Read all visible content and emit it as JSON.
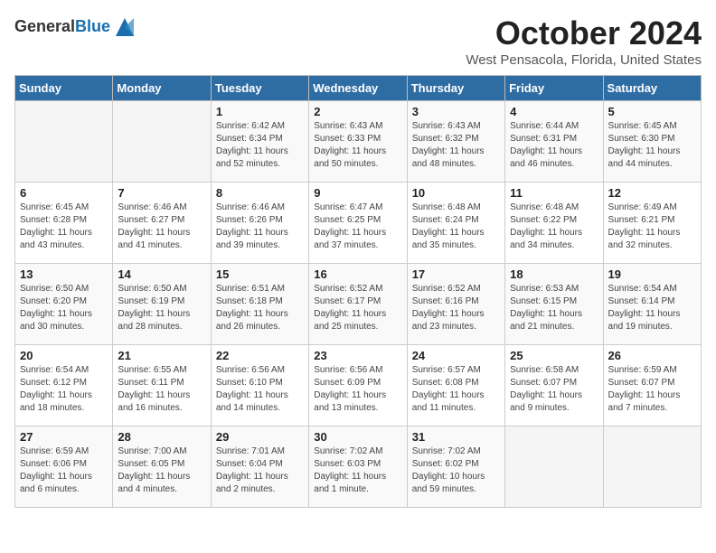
{
  "logo": {
    "general": "General",
    "blue": "Blue"
  },
  "title": "October 2024",
  "subtitle": "West Pensacola, Florida, United States",
  "days_header": [
    "Sunday",
    "Monday",
    "Tuesday",
    "Wednesday",
    "Thursday",
    "Friday",
    "Saturday"
  ],
  "weeks": [
    [
      {
        "day": "",
        "detail": ""
      },
      {
        "day": "",
        "detail": ""
      },
      {
        "day": "1",
        "detail": "Sunrise: 6:42 AM\nSunset: 6:34 PM\nDaylight: 11 hours\nand 52 minutes."
      },
      {
        "day": "2",
        "detail": "Sunrise: 6:43 AM\nSunset: 6:33 PM\nDaylight: 11 hours\nand 50 minutes."
      },
      {
        "day": "3",
        "detail": "Sunrise: 6:43 AM\nSunset: 6:32 PM\nDaylight: 11 hours\nand 48 minutes."
      },
      {
        "day": "4",
        "detail": "Sunrise: 6:44 AM\nSunset: 6:31 PM\nDaylight: 11 hours\nand 46 minutes."
      },
      {
        "day": "5",
        "detail": "Sunrise: 6:45 AM\nSunset: 6:30 PM\nDaylight: 11 hours\nand 44 minutes."
      }
    ],
    [
      {
        "day": "6",
        "detail": "Sunrise: 6:45 AM\nSunset: 6:28 PM\nDaylight: 11 hours\nand 43 minutes."
      },
      {
        "day": "7",
        "detail": "Sunrise: 6:46 AM\nSunset: 6:27 PM\nDaylight: 11 hours\nand 41 minutes."
      },
      {
        "day": "8",
        "detail": "Sunrise: 6:46 AM\nSunset: 6:26 PM\nDaylight: 11 hours\nand 39 minutes."
      },
      {
        "day": "9",
        "detail": "Sunrise: 6:47 AM\nSunset: 6:25 PM\nDaylight: 11 hours\nand 37 minutes."
      },
      {
        "day": "10",
        "detail": "Sunrise: 6:48 AM\nSunset: 6:24 PM\nDaylight: 11 hours\nand 35 minutes."
      },
      {
        "day": "11",
        "detail": "Sunrise: 6:48 AM\nSunset: 6:22 PM\nDaylight: 11 hours\nand 34 minutes."
      },
      {
        "day": "12",
        "detail": "Sunrise: 6:49 AM\nSunset: 6:21 PM\nDaylight: 11 hours\nand 32 minutes."
      }
    ],
    [
      {
        "day": "13",
        "detail": "Sunrise: 6:50 AM\nSunset: 6:20 PM\nDaylight: 11 hours\nand 30 minutes."
      },
      {
        "day": "14",
        "detail": "Sunrise: 6:50 AM\nSunset: 6:19 PM\nDaylight: 11 hours\nand 28 minutes."
      },
      {
        "day": "15",
        "detail": "Sunrise: 6:51 AM\nSunset: 6:18 PM\nDaylight: 11 hours\nand 26 minutes."
      },
      {
        "day": "16",
        "detail": "Sunrise: 6:52 AM\nSunset: 6:17 PM\nDaylight: 11 hours\nand 25 minutes."
      },
      {
        "day": "17",
        "detail": "Sunrise: 6:52 AM\nSunset: 6:16 PM\nDaylight: 11 hours\nand 23 minutes."
      },
      {
        "day": "18",
        "detail": "Sunrise: 6:53 AM\nSunset: 6:15 PM\nDaylight: 11 hours\nand 21 minutes."
      },
      {
        "day": "19",
        "detail": "Sunrise: 6:54 AM\nSunset: 6:14 PM\nDaylight: 11 hours\nand 19 minutes."
      }
    ],
    [
      {
        "day": "20",
        "detail": "Sunrise: 6:54 AM\nSunset: 6:12 PM\nDaylight: 11 hours\nand 18 minutes."
      },
      {
        "day": "21",
        "detail": "Sunrise: 6:55 AM\nSunset: 6:11 PM\nDaylight: 11 hours\nand 16 minutes."
      },
      {
        "day": "22",
        "detail": "Sunrise: 6:56 AM\nSunset: 6:10 PM\nDaylight: 11 hours\nand 14 minutes."
      },
      {
        "day": "23",
        "detail": "Sunrise: 6:56 AM\nSunset: 6:09 PM\nDaylight: 11 hours\nand 13 minutes."
      },
      {
        "day": "24",
        "detail": "Sunrise: 6:57 AM\nSunset: 6:08 PM\nDaylight: 11 hours\nand 11 minutes."
      },
      {
        "day": "25",
        "detail": "Sunrise: 6:58 AM\nSunset: 6:07 PM\nDaylight: 11 hours\nand 9 minutes."
      },
      {
        "day": "26",
        "detail": "Sunrise: 6:59 AM\nSunset: 6:07 PM\nDaylight: 11 hours\nand 7 minutes."
      }
    ],
    [
      {
        "day": "27",
        "detail": "Sunrise: 6:59 AM\nSunset: 6:06 PM\nDaylight: 11 hours\nand 6 minutes."
      },
      {
        "day": "28",
        "detail": "Sunrise: 7:00 AM\nSunset: 6:05 PM\nDaylight: 11 hours\nand 4 minutes."
      },
      {
        "day": "29",
        "detail": "Sunrise: 7:01 AM\nSunset: 6:04 PM\nDaylight: 11 hours\nand 2 minutes."
      },
      {
        "day": "30",
        "detail": "Sunrise: 7:02 AM\nSunset: 6:03 PM\nDaylight: 11 hours\nand 1 minute."
      },
      {
        "day": "31",
        "detail": "Sunrise: 7:02 AM\nSunset: 6:02 PM\nDaylight: 10 hours\nand 59 minutes."
      },
      {
        "day": "",
        "detail": ""
      },
      {
        "day": "",
        "detail": ""
      }
    ]
  ]
}
